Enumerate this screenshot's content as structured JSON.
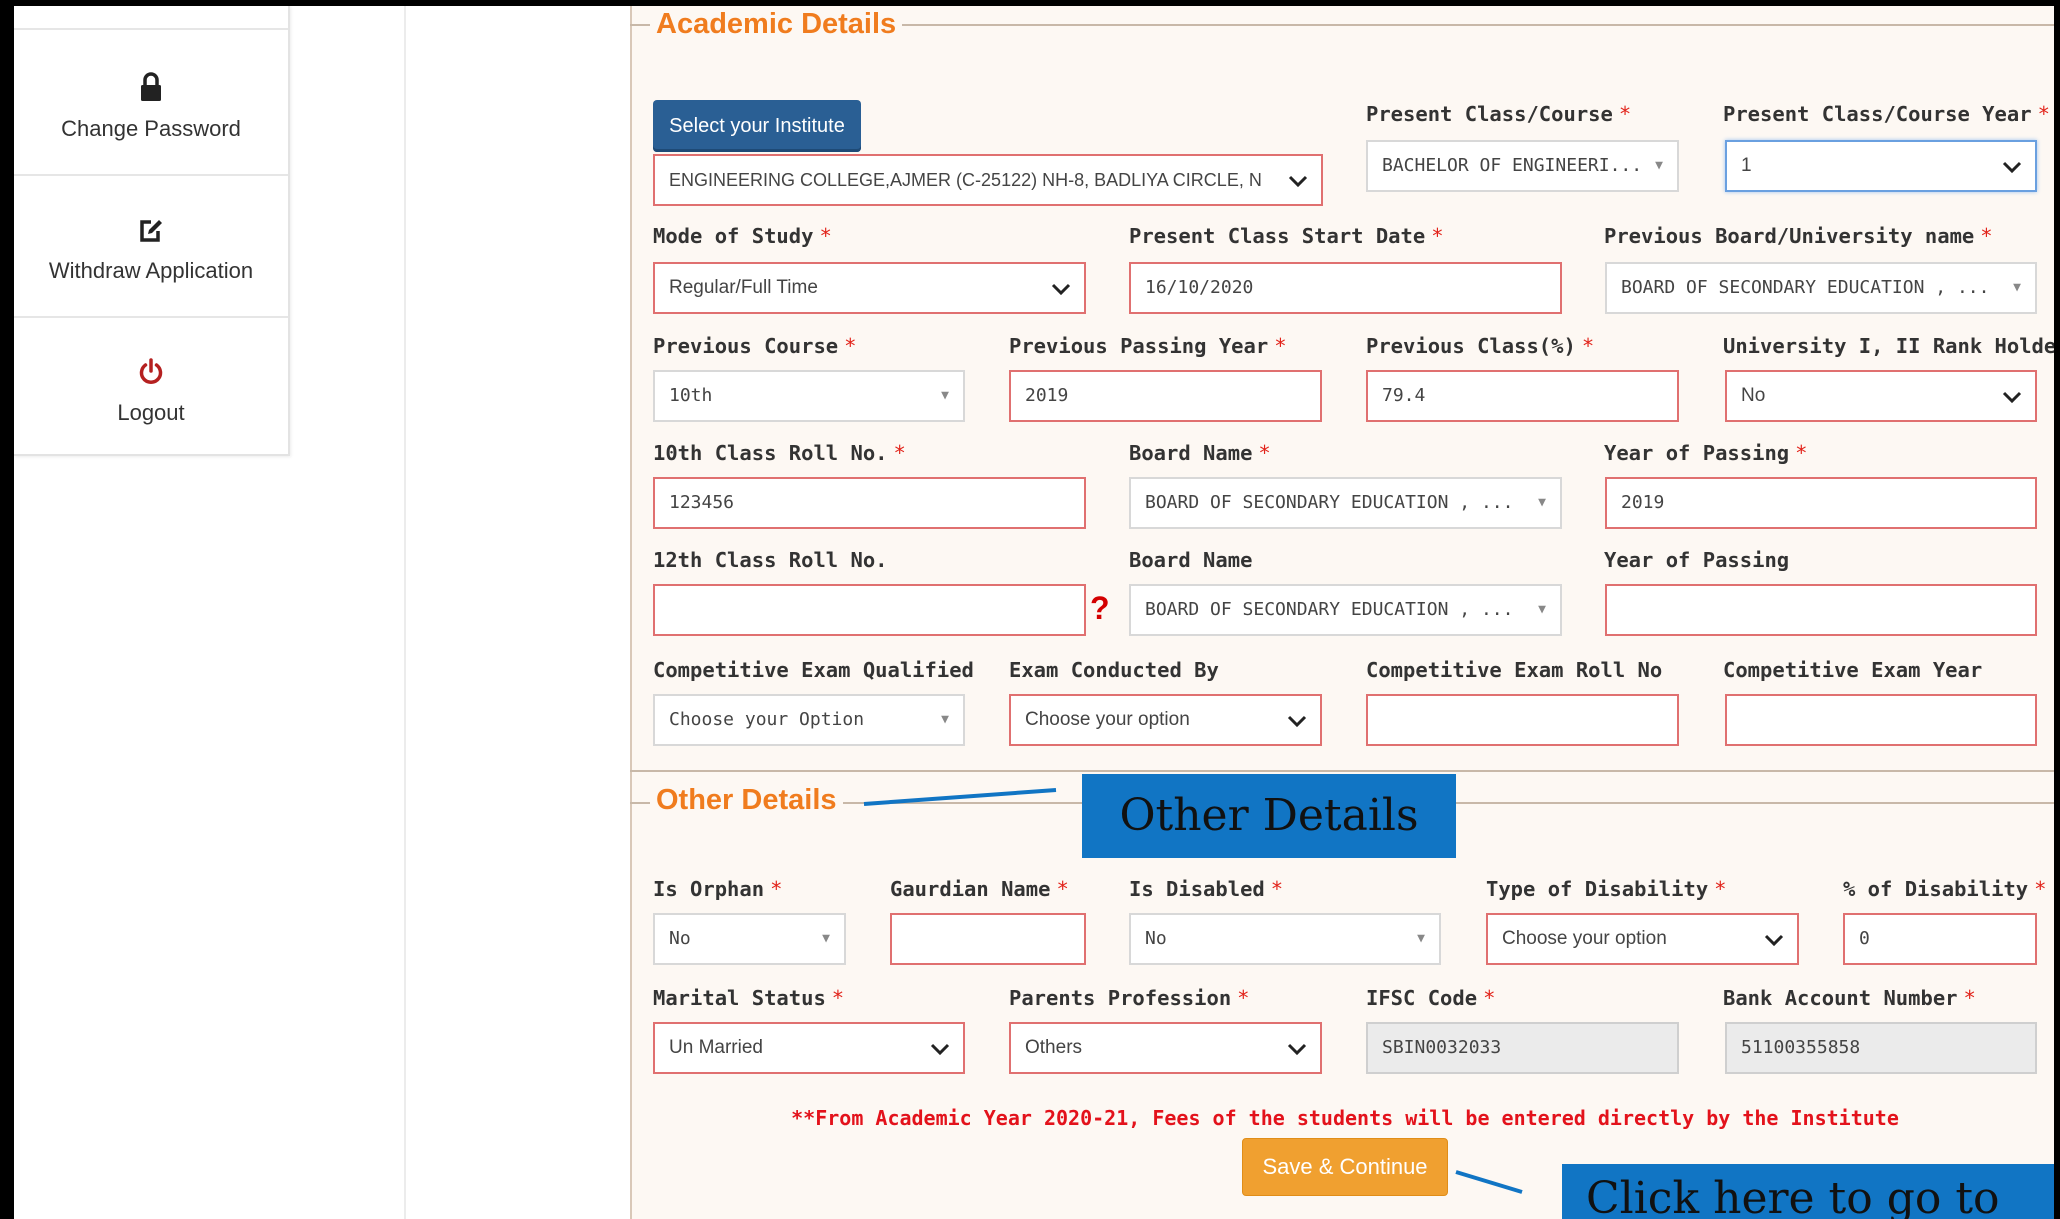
{
  "sidebar": {
    "items": [
      {
        "label": "Change Password",
        "icon": "lock-icon"
      },
      {
        "label": "Withdraw Application",
        "icon": "edit-icon"
      },
      {
        "label": "Logout",
        "icon": "power-icon"
      }
    ]
  },
  "academic": {
    "legend": "Academic Details",
    "select_institute_button": "Select your Institute",
    "institute_value": "ENGINEERING COLLEGE,AJMER (C-25122) NH-8, BADLIYA CIRCLE, N",
    "present_course": {
      "label": "Present Class/Course",
      "value": "BACHELOR OF ENGINEERI..."
    },
    "present_course_year": {
      "label": "Present Class/Course Year",
      "value": "1"
    },
    "mode_of_study": {
      "label": "Mode of Study",
      "value": "Regular/Full Time"
    },
    "start_date": {
      "label": "Present Class Start Date",
      "value": "16/10/2020"
    },
    "prev_board": {
      "label": "Previous Board/University name",
      "value": "BOARD OF SECONDARY EDUCATION , ..."
    },
    "prev_course": {
      "label": "Previous Course",
      "value": "10th"
    },
    "prev_year": {
      "label": "Previous Passing Year",
      "value": "2019"
    },
    "prev_percent": {
      "label": "Previous Class(%)",
      "value": "79.4"
    },
    "rank_holder": {
      "label": "University I, II Rank Holder",
      "value": "No"
    },
    "roll10": {
      "label": "10th Class Roll No.",
      "value": "123456"
    },
    "board10": {
      "label": "Board Name",
      "value": "BOARD OF SECONDARY EDUCATION , ..."
    },
    "year10": {
      "label": "Year of Passing",
      "value": "2019"
    },
    "roll12": {
      "label": "12th Class Roll No.",
      "value": ""
    },
    "help_mark": "?",
    "board12": {
      "label": "Board Name",
      "value": "BOARD OF SECONDARY EDUCATION , ..."
    },
    "year12": {
      "label": "Year of Passing",
      "value": ""
    },
    "comp_exam": {
      "label": "Competitive Exam Qualified",
      "value": "Choose your Option"
    },
    "exam_by": {
      "label": "Exam Conducted By",
      "value": "Choose your option"
    },
    "comp_roll": {
      "label": "Competitive Exam Roll No",
      "value": ""
    },
    "comp_year": {
      "label": "Competitive Exam Year",
      "value": ""
    }
  },
  "other": {
    "legend": "Other Details",
    "orphan": {
      "label": "Is Orphan",
      "value": "No"
    },
    "guardian": {
      "label": "Gaurdian Name",
      "value": ""
    },
    "disabled": {
      "label": "Is Disabled",
      "value": "No"
    },
    "disability_type": {
      "label": "Type of Disability",
      "value": "Choose your option"
    },
    "disability_pct": {
      "label": "% of Disability",
      "value": "0"
    },
    "marital": {
      "label": "Marital Status",
      "value": "Un Married"
    },
    "parents_prof": {
      "label": "Parents Profession",
      "value": "Others"
    },
    "ifsc": {
      "label": "IFSC Code",
      "value": "SBIN0032033"
    },
    "bank_acc": {
      "label": "Bank Account Number",
      "value": "51100355858"
    }
  },
  "required_mark": "*",
  "note": "**From Academic Year 2020-21, Fees of the students will be entered directly by the Institute",
  "save_button": "Save & Continue",
  "annotations": {
    "other_details": "Other Details",
    "click_here": "Click here to go to"
  },
  "colors": {
    "accent": "#f07c1e",
    "required": "#e2231a",
    "button_blue": "#2a5f94",
    "save_orange": "#f0a030",
    "callout_blue": "#1175c4"
  }
}
